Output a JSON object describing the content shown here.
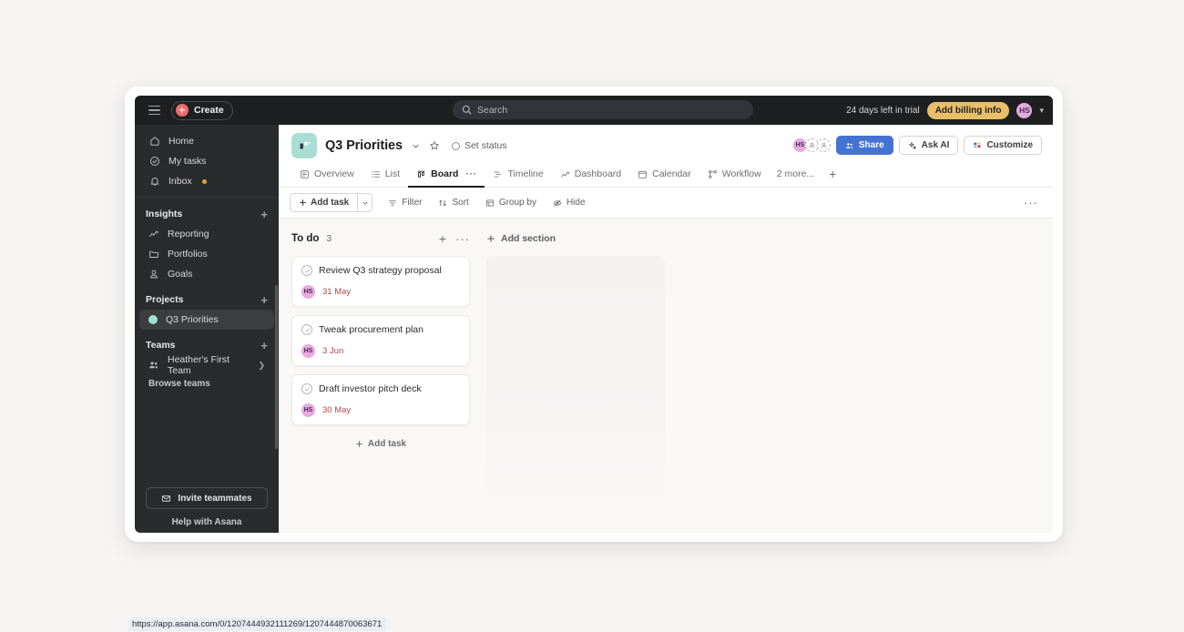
{
  "topbar": {
    "menu_icon": "hamburger-icon",
    "create_label": "Create",
    "search_placeholder": "Search",
    "trial_text": "24 days left in trial",
    "billing_label": "Add billing info",
    "user_initials": "HS"
  },
  "sidebar": {
    "top_items": [
      {
        "label": "Home",
        "icon": "home-icon"
      },
      {
        "label": "My tasks",
        "icon": "check-circle-icon"
      },
      {
        "label": "Inbox",
        "icon": "bell-icon",
        "badge": true
      }
    ],
    "insights": {
      "header": "Insights",
      "items": [
        {
          "label": "Reporting",
          "icon": "chart-line-icon"
        },
        {
          "label": "Portfolios",
          "icon": "folder-icon"
        },
        {
          "label": "Goals",
          "icon": "goal-icon"
        }
      ]
    },
    "projects": {
      "header": "Projects",
      "items": [
        {
          "label": "Q3 Priorities",
          "color": "#9ee0d4",
          "active": true
        }
      ]
    },
    "teams": {
      "header": "Teams",
      "items": [
        {
          "label": "Heather's First Team",
          "icon": "people-icon"
        }
      ],
      "browse_label": "Browse teams"
    },
    "invite_label": "Invite teammates",
    "help_label": "Help with Asana"
  },
  "project": {
    "title": "Q3 Priorities",
    "icon_color": "#a8ded5",
    "status_label": "Set status",
    "members": [
      {
        "initials": "HS"
      }
    ],
    "actions": [
      {
        "label": "Share",
        "icon": "share-icon",
        "primary": true
      },
      {
        "label": "Ask AI",
        "icon": "sparkle-icon",
        "primary": false
      },
      {
        "label": "Customize",
        "icon": "grid-icon",
        "primary": false
      }
    ]
  },
  "tabs": [
    {
      "label": "Overview",
      "icon": "overview-icon",
      "active": false
    },
    {
      "label": "List",
      "icon": "list-icon",
      "active": false
    },
    {
      "label": "Board",
      "icon": "board-icon",
      "active": true
    },
    {
      "label": "Timeline",
      "icon": "timeline-icon",
      "active": false
    },
    {
      "label": "Dashboard",
      "icon": "dashboard-icon",
      "active": false
    },
    {
      "label": "Calendar",
      "icon": "calendar-icon",
      "active": false
    },
    {
      "label": "Workflow",
      "icon": "workflow-icon",
      "active": false
    }
  ],
  "tabs_more_label": "2 more...",
  "toolbar": {
    "add_task_label": "Add task",
    "filter_label": "Filter",
    "sort_label": "Sort",
    "group_by_label": "Group by",
    "hide_label": "Hide"
  },
  "board": {
    "add_section_label": "Add section",
    "columns": [
      {
        "title": "To do",
        "count": "3",
        "add_task_label": "Add task",
        "cards": [
          {
            "title": "Review Q3 strategy proposal",
            "assignee": "HS",
            "due": "31 May"
          },
          {
            "title": "Tweak procurement plan",
            "assignee": "HS",
            "due": "3 Jun"
          },
          {
            "title": "Draft investor pitch deck",
            "assignee": "HS",
            "due": "30 May"
          }
        ]
      }
    ]
  },
  "status_url": "https://app.asana.com/0/1207444932111269/1207444870063671",
  "colors": {
    "accent_blue": "#4573d2",
    "create_red": "#f06a6a",
    "billing_gold": "#e8bf68",
    "avatar_pink": "#e6a9e0",
    "due_red": "#b04a4a",
    "project_teal": "#a8ded5"
  }
}
